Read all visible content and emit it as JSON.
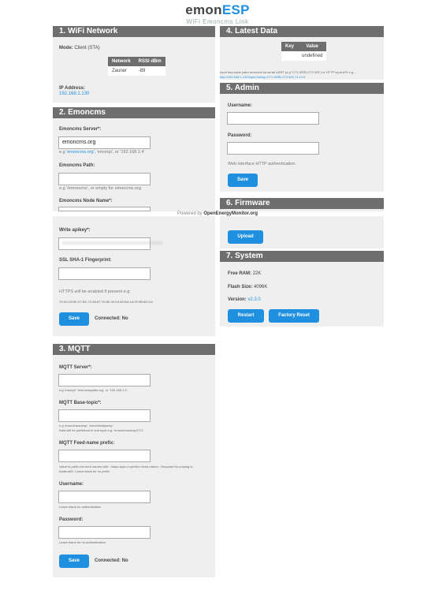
{
  "header": {
    "brand_prefix": "emon",
    "brand_suffix": "ESP",
    "subtitle": "WiFi Emoncms Link"
  },
  "wifi": {
    "title": "1. WiFi Network",
    "mode_label": "Mode:",
    "mode_value": "Client (STA)",
    "table_headers": [
      "Network",
      "RSSI dBm"
    ],
    "table_row": [
      "Zauner",
      "-89"
    ],
    "ip_label": "IP Address:",
    "ip_value": "192.168.1.130"
  },
  "emoncms": {
    "title": "2. Emoncms",
    "server_label": "Emoncms Server*:",
    "server_value": "emoncms.org",
    "server_hint_prefix": "e.g '",
    "server_hint_link": "emoncms.org",
    "server_hint_suffix": "', 'emonpi', or '192.168.1.4'",
    "path_label": "Emoncms Path:",
    "path_hint": "e.g '/emoncms', or empty for emoncms.org",
    "node_label": "Emoncms Node Name*:",
    "apikey_label": "Write apikey*:",
    "apikey_value": "xxxxxxxxxxxxxxxxxxxxxxxxxxxxxxxx",
    "ssl_label": "SSL SHA-1 Fingerprint:",
    "https_hint": "HTTPS will be enabled if present e.g:",
    "fingerprint_example": "7D:82:15:BE:D7:BC:72:58:87:7D:8E:40:D4:80:BA:1A:9F:8B:8D:DA",
    "save_label": "Save",
    "connected_label": "Connected:",
    "connected_value": "No"
  },
  "mqtt": {
    "title": "3. MQTT",
    "server_label": "MQTT Server*:",
    "server_hint": "e.g 'emonpi', 'test.mosquitto.org', or '192.168.1.4'",
    "topic_label": "MQTT Base-topic*:",
    "topic_hint1": "e.g 'emon/emonesp', 'emon/heatpump'",
    "topic_hint2": "Data will be published to sub topic e.g. 'emon/emonesp/CT1'",
    "prefix_label": "MQTT Feed-name prefix:",
    "prefix_hint1": "Value to prefix the feed names with: <base-topic>/<prefix><feed-name>. Required for posting to",
    "prefix_hint2": "AdafruitIO. Leave blank for no prefix.",
    "user_label": "Username:",
    "user_hint": "Leave blank for authentication",
    "pass_label": "Password:",
    "pass_hint": "Leave blank for no authentication",
    "save_label": "Save",
    "connected_label": "Connected:",
    "connected_value": "No"
  },
  "latest": {
    "title": "4. Latest Data",
    "headers": [
      "Key",
      "Value"
    ],
    "value": "undefined",
    "note1": "Input key:value pairs received via serial UART (e.g \"CT1:3935,CT2:325\") or HTTP input API e.g...",
    "note2": "http://192.168.1.130/input?string=CT1:3935,CT2:325,T1:12.5"
  },
  "admin": {
    "title": "5. Admin",
    "user_label": "Username:",
    "pass_label": "Password:",
    "hint": "Web interface HTTP authentication.",
    "save_label": "Save"
  },
  "firmware": {
    "title": "6. Firmware",
    "upload_label": "Upload"
  },
  "system": {
    "title": "7. System",
    "ram_label": "Free RAM:",
    "ram_value": "22K",
    "flash_label": "Flash Size:",
    "flash_value": "4096K",
    "version_label": "Version:",
    "version_value": "v2.3.0",
    "restart_label": "Restart",
    "factory_label": "Factory Reset"
  },
  "footer": {
    "prefix": "Powered by ",
    "link": "OpenEnergyMonitor.org"
  }
}
